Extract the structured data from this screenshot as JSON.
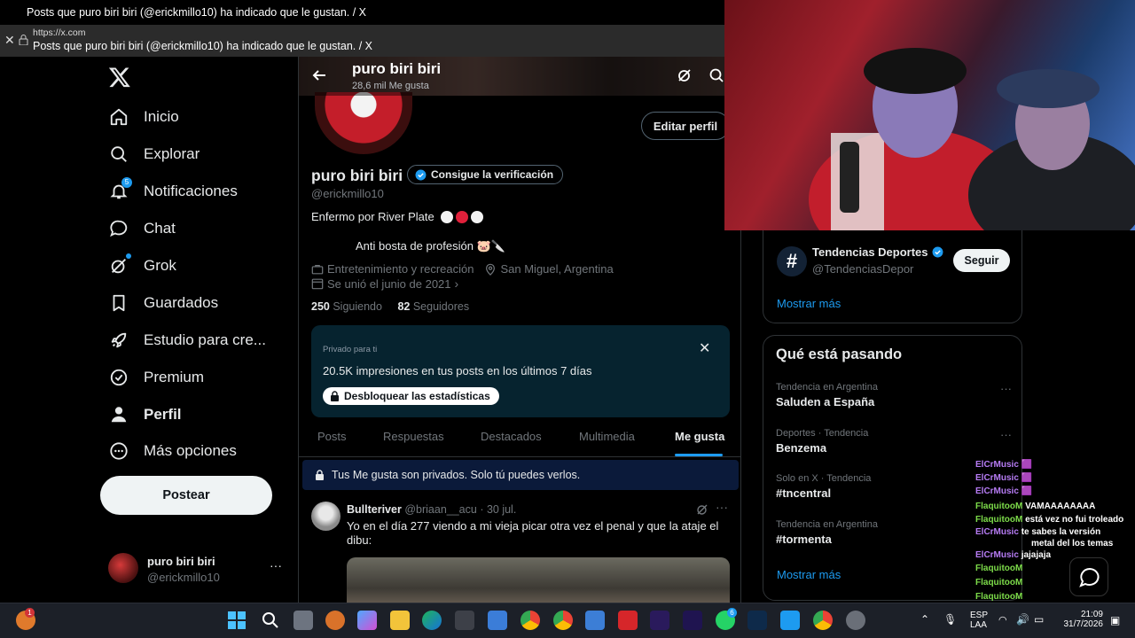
{
  "window": {
    "title": "Posts que puro biri biri (@erickmillo10) ha indicado que le gustan. / X",
    "url": "https://x.com",
    "page_title": "Posts que puro biri biri (@erickmillo10) ha indicado que le gustan. / X"
  },
  "nav": {
    "items": [
      {
        "label": "Inicio",
        "icon": "home-icon"
      },
      {
        "label": "Explorar",
        "icon": "search-icon"
      },
      {
        "label": "Notificaciones",
        "icon": "bell-icon",
        "badge": "5"
      },
      {
        "label": "Chat",
        "icon": "chat-bubble-icon"
      },
      {
        "label": "Grok",
        "icon": "grok-icon"
      },
      {
        "label": "Guardados",
        "icon": "bookmark-icon"
      },
      {
        "label": "Estudio para cre...",
        "icon": "rocket-icon"
      },
      {
        "label": "Premium",
        "icon": "premium-check-icon"
      },
      {
        "label": "Perfil",
        "icon": "person-icon"
      },
      {
        "label": "Más opciones",
        "icon": "more-circle-icon"
      }
    ],
    "post_button": "Postear",
    "account": {
      "name": "puro biri biri",
      "handle": "@erickmillo10",
      "more": "···"
    }
  },
  "profile": {
    "header_name": "puro biri biri",
    "likes_count": "28,6 mil Me gusta",
    "edit_button": "Editar perfil",
    "name": "puro biri biri",
    "verify_button": "Consigue la verificación",
    "handle": "@erickmillo10",
    "bio_line1": "Enfermo por River Plate",
    "bio_line2": "Anti bosta de profesión 🐷🔪",
    "category": "Entretenimiento y recreación",
    "location": "San Miguel, Argentina",
    "joined": "Se unió el junio de 2021",
    "following_count": "250",
    "following_label": "Siguiendo",
    "followers_count": "82",
    "followers_label": "Seguidores",
    "promo": {
      "label": "Privado para ti",
      "text": "20.5K impresiones en tus posts en los últimos 7 días",
      "button": "Desbloquear las estadísticas"
    },
    "tabs": [
      "Posts",
      "Respuestas",
      "Destacados",
      "Multimedia",
      "Me gusta"
    ],
    "active_tab": "Me gusta",
    "private_notice": "Tus Me gusta son privados. Solo tú puedes verlos."
  },
  "tweet": {
    "author": "Bullteriver",
    "handle": "@briaan__acu",
    "date": "· 30 jul.",
    "text": "Yo en el día 277 viendo a mi vieja picar otra vez el penal y que la ataje el dibu:"
  },
  "right": {
    "suggest": {
      "name": "Tendencias Deportes",
      "handle": "@TendenciasDepor",
      "follow": "Seguir",
      "show_more": "Mostrar más"
    },
    "trends_title": "Qué está pasando",
    "trends": [
      {
        "context": "Tendencia en Argentina",
        "name": "Saluden a España"
      },
      {
        "context": "Deportes · Tendencia",
        "name": "Benzema"
      },
      {
        "context": "Solo en X · Tendencia",
        "name": "#tncentral"
      },
      {
        "context": "Tendencia en Argentina",
        "name": "#tormenta"
      }
    ],
    "trends_more": "Mostrar más"
  },
  "chat": {
    "rows": [
      {
        "user": "ElCrMusic",
        "msg": "🟪"
      },
      {
        "user": "ElCrMusic",
        "msg": "🟪"
      },
      {
        "user": "ElCrMusic",
        "msg": "🟪"
      },
      {
        "user": "FlaquitooM",
        "msg": "VAMAAAAAAAA"
      },
      {
        "user": "FlaquitooM",
        "msg": "está vez no fui troleado"
      },
      {
        "user": "ElCrMusic",
        "msg": "te sabes la versión"
      },
      {
        "user": "",
        "msg": "metal del los temas"
      },
      {
        "user": "ElCrMusic",
        "msg": "jajajaja"
      },
      {
        "user": "FlaquitooM",
        "msg": ""
      },
      {
        "user": "FlaquitooM",
        "msg": ""
      },
      {
        "user": "FlaquitooM",
        "msg": ""
      }
    ]
  },
  "taskbar": {
    "lang": "ESP",
    "lang2": "LAA",
    "time": "21:09",
    "date": "31/7/2026",
    "badge_notif": "1",
    "badge_whatsapp": "6"
  },
  "colors": {
    "accent": "#1d9bf0",
    "river_red": "#e0203a"
  }
}
